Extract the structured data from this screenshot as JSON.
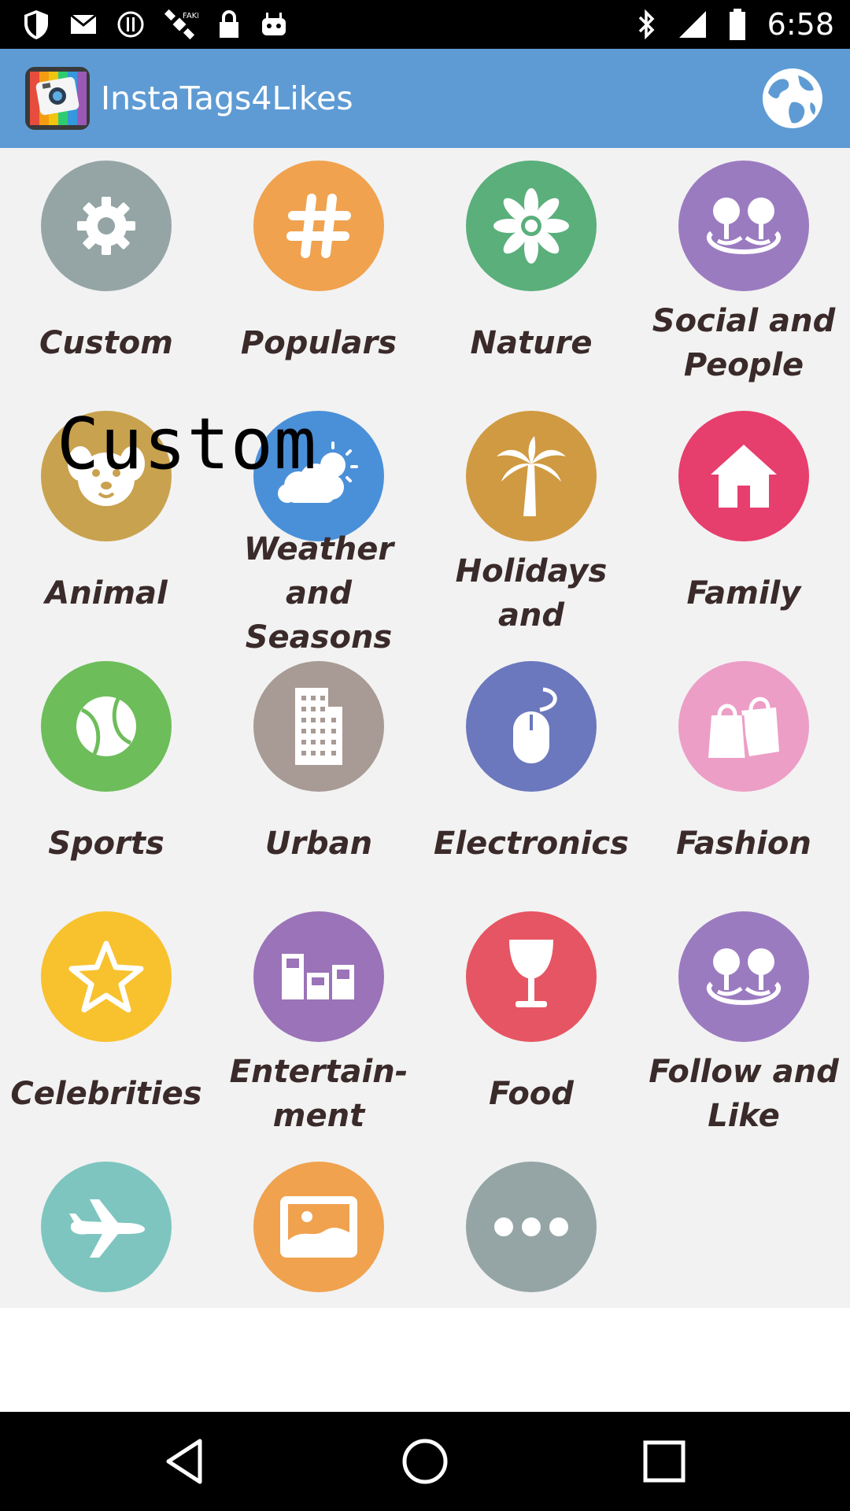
{
  "status_bar": {
    "time": "6:58",
    "left_icons": [
      "shield-icon",
      "mail-icon",
      "alert-icon",
      "satellite-icon",
      "lock-icon",
      "robot-icon"
    ],
    "right_icons": [
      "bluetooth-icon",
      "signal-icon",
      "battery-icon"
    ]
  },
  "app_bar": {
    "title": "InstaTags4Likes",
    "logo_icon": "app-camera-logo",
    "action_icon": "globe-icon"
  },
  "overlay": {
    "text": "Custom"
  },
  "categories": [
    {
      "label": "Custom",
      "icon": "gear-icon",
      "color": "#95a5a6"
    },
    {
      "label": "Populars",
      "icon": "hashtag-icon",
      "color": "#f0a24f"
    },
    {
      "label": "Nature",
      "icon": "flower-icon",
      "color": "#5aaf7b"
    },
    {
      "label": "Social and\nPeople",
      "icon": "people-icon",
      "color": "#9b7bc0"
    },
    {
      "label": "Animal",
      "icon": "dog-icon",
      "color": "#c9a24f"
    },
    {
      "label": "Weather and\nSeasons",
      "icon": "weather-icon",
      "color": "#4a90d9"
    },
    {
      "label": "Holidays\nand",
      "icon": "palm-tree-icon",
      "color": "#d09a42"
    },
    {
      "label": "Family",
      "icon": "home-icon",
      "color": "#e63e6d"
    },
    {
      "label": "Sports",
      "icon": "ball-icon",
      "color": "#6dbd5a"
    },
    {
      "label": "Urban",
      "icon": "building-icon",
      "color": "#a89a94"
    },
    {
      "label": "Electronics",
      "icon": "mouse-icon",
      "color": "#6b78bd"
    },
    {
      "label": "Fashion",
      "icon": "shopping-bag-icon",
      "color": "#ec9ec6"
    },
    {
      "label": "Celebrities",
      "icon": "star-icon",
      "color": "#f8c12e"
    },
    {
      "label": "Entertain-\nment",
      "icon": "podium-icon",
      "color": "#9b73b8"
    },
    {
      "label": "Food",
      "icon": "wine-glass-icon",
      "color": "#e65563"
    },
    {
      "label": "Follow and\nLike",
      "icon": "people-icon",
      "color": "#9b7bc0"
    },
    {
      "label": "",
      "icon": "airplane-icon",
      "color": "#7ec5c0"
    },
    {
      "label": "",
      "icon": "picture-icon",
      "color": "#f0a24f"
    },
    {
      "label": "",
      "icon": "more-icon",
      "color": "#95a5a6"
    }
  ],
  "nav_bar": {
    "buttons": [
      "back-icon",
      "home-icon",
      "recents-icon"
    ]
  }
}
